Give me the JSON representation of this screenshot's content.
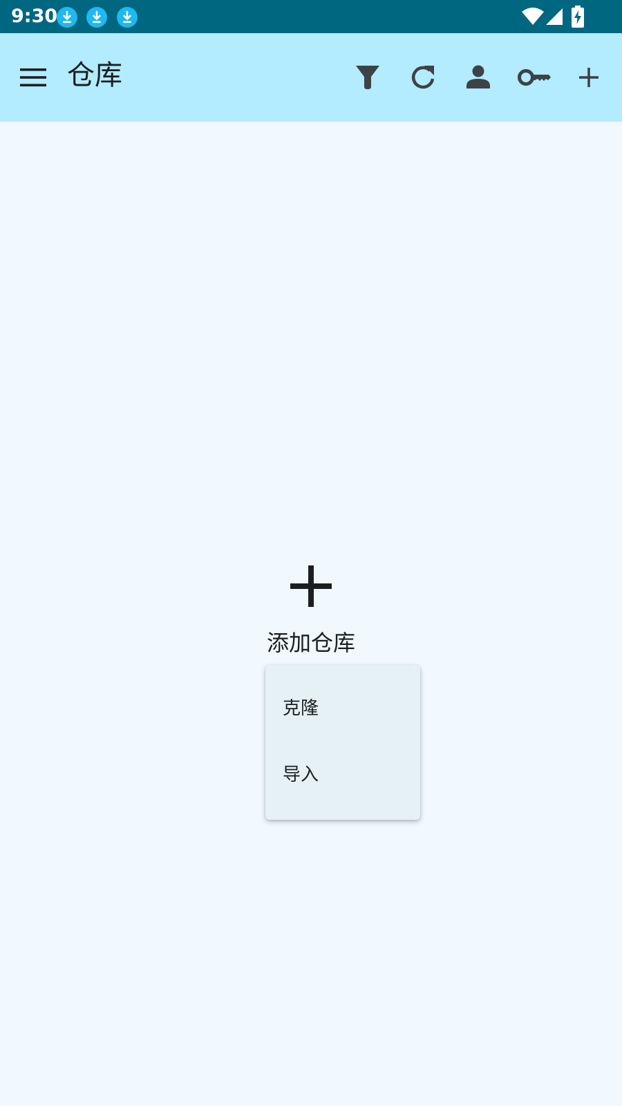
{
  "status_bar": {
    "time": "9:30",
    "background": "#006781",
    "notification_icons": [
      "download-icon",
      "download-icon",
      "download-icon"
    ],
    "right_icons": [
      "wifi-icon",
      "cell-signal-icon",
      "battery-charging-icon"
    ]
  },
  "app_bar": {
    "title": "仓库",
    "background": "#b3ebff",
    "nav_icon": "menu-icon",
    "actions": [
      "filter-icon",
      "refresh-icon",
      "person-icon",
      "key-icon",
      "add-icon"
    ]
  },
  "empty_state": {
    "icon": "add-icon",
    "label": "添加仓库"
  },
  "popup_menu": {
    "items": [
      {
        "label": "克隆"
      },
      {
        "label": "导入"
      }
    ]
  },
  "colors": {
    "page_background": "#f1f8fe",
    "menu_background": "#e5f1f5",
    "icon_color": "#3c4347",
    "text_color": "#1b1f22"
  }
}
